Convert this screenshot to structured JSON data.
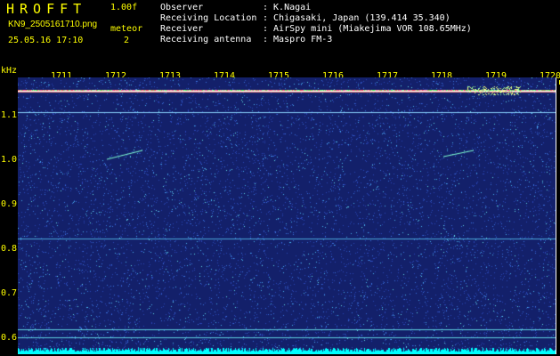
{
  "header": {
    "title": "HROFFT",
    "version": "1.00f",
    "filename": "KN9_2505161710.png",
    "meteor_label": "meteor",
    "datetime": "25.05.16 17:10",
    "meteor_count": "2"
  },
  "info": {
    "observer_key": "Observer",
    "observer_val": ": K.Nagai",
    "location_key": "Receiving Location",
    "location_val": ": Chigasaki, Japan (139.414 35.340)",
    "receiver_key": "Receiver",
    "receiver_val": ": AirSpy mini (Miakejima VOR 108.65MHz)",
    "antenna_key": "Receiving antenna",
    "antenna_val": ": Maspro FM-3"
  },
  "axes": {
    "y_unit": "kHz",
    "y_ticks": [
      "1.1",
      "1.0",
      "0.9",
      "0.8",
      "0.7",
      "0.6"
    ],
    "x_ticks": [
      "1711",
      "1712",
      "1713",
      "1714",
      "1715",
      "1716",
      "1717",
      "1718",
      "1719",
      "1720"
    ]
  },
  "colors": {
    "background": "#13206a",
    "header_text": "#ffff00",
    "info_text": "#ffffff",
    "noise_baseline": "#00ffff"
  }
}
